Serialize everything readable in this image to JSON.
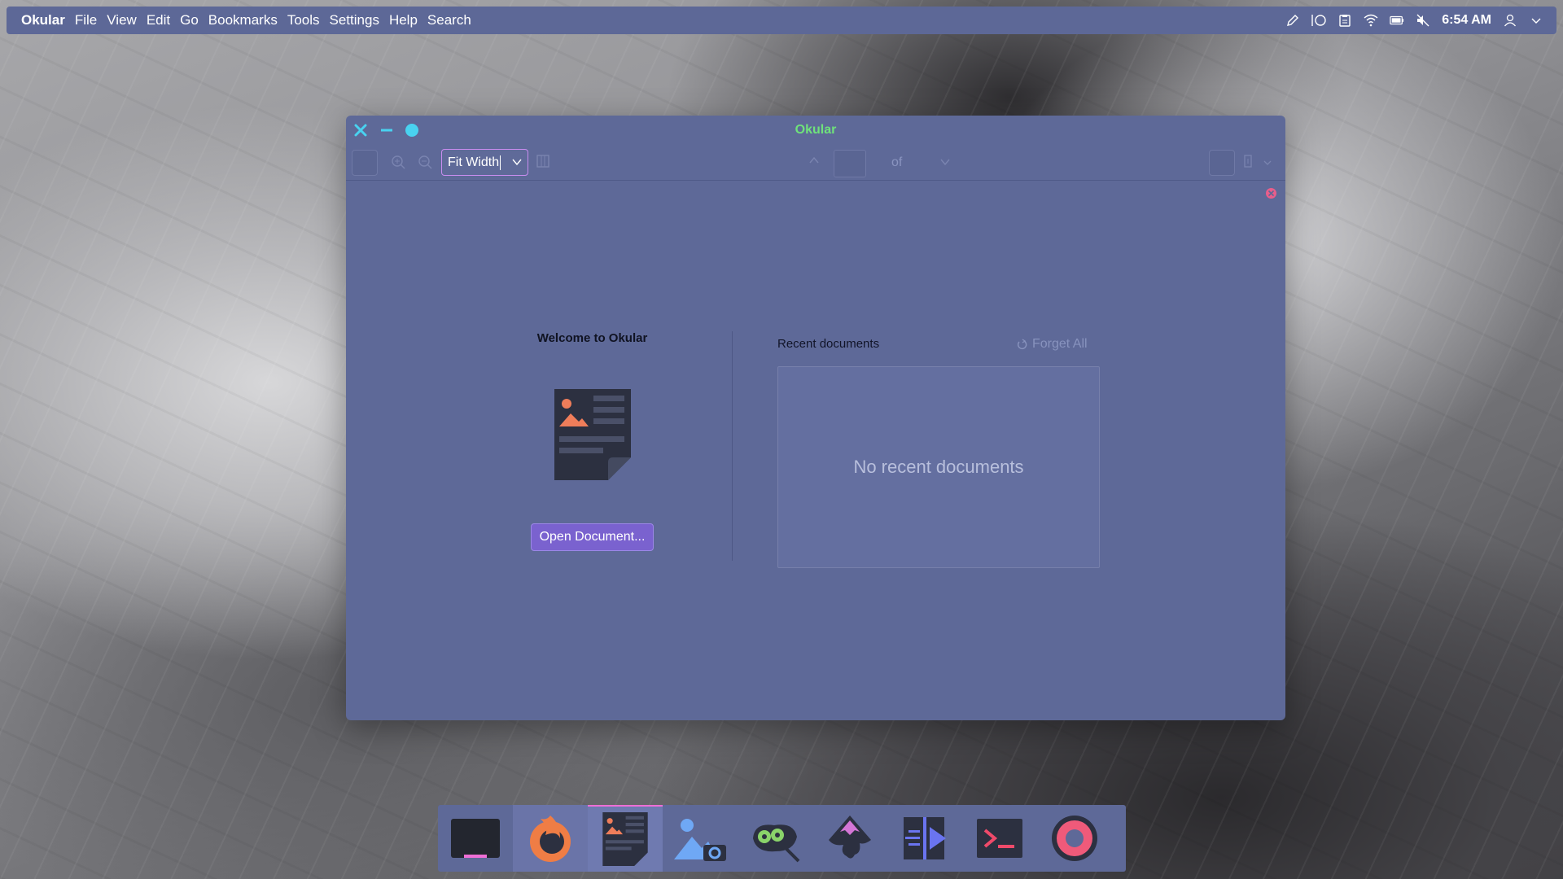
{
  "top_panel": {
    "menu": [
      "Okular",
      "File",
      "View",
      "Edit",
      "Go",
      "Bookmarks",
      "Tools",
      "Settings",
      "Help",
      "Search"
    ],
    "tray_icons": [
      "pen-icon",
      "circle-icon",
      "clipboard-icon",
      "wifi-icon",
      "battery-icon",
      "volume-muted-icon"
    ],
    "clock": "6:54 AM",
    "user_icon": "user-icon",
    "expand_icon": "chevron-down-icon"
  },
  "window": {
    "title": "Okular",
    "controls": [
      "close",
      "minimize",
      "maximize"
    ],
    "title_color": "#6fe27b"
  },
  "toolbar": {
    "zoom_value": "Fit Width",
    "page_of": "of"
  },
  "welcome": {
    "title": "Welcome to Okular",
    "open_button": "Open Document...",
    "recent_header": "Recent documents",
    "forget_all": "Forget All",
    "empty_message": "No recent documents"
  },
  "dock": {
    "items": [
      {
        "name": "terminal-window",
        "icon": "window-icon"
      },
      {
        "name": "firefox",
        "icon": "firefox-icon"
      },
      {
        "name": "okular",
        "icon": "document-icon",
        "active": true
      },
      {
        "name": "image-viewer",
        "icon": "image-camera-icon"
      },
      {
        "name": "gimp",
        "icon": "gimp-icon"
      },
      {
        "name": "inkscape",
        "icon": "inkscape-icon"
      },
      {
        "name": "kdenlive",
        "icon": "media-icon"
      },
      {
        "name": "konsole",
        "icon": "console-icon"
      },
      {
        "name": "settings",
        "icon": "settings-icon"
      }
    ]
  },
  "colors": {
    "panel": "#5d6897",
    "accent": "#7a62cf",
    "accent_border": "#c98df0",
    "dismiss": "#e85e8b"
  }
}
